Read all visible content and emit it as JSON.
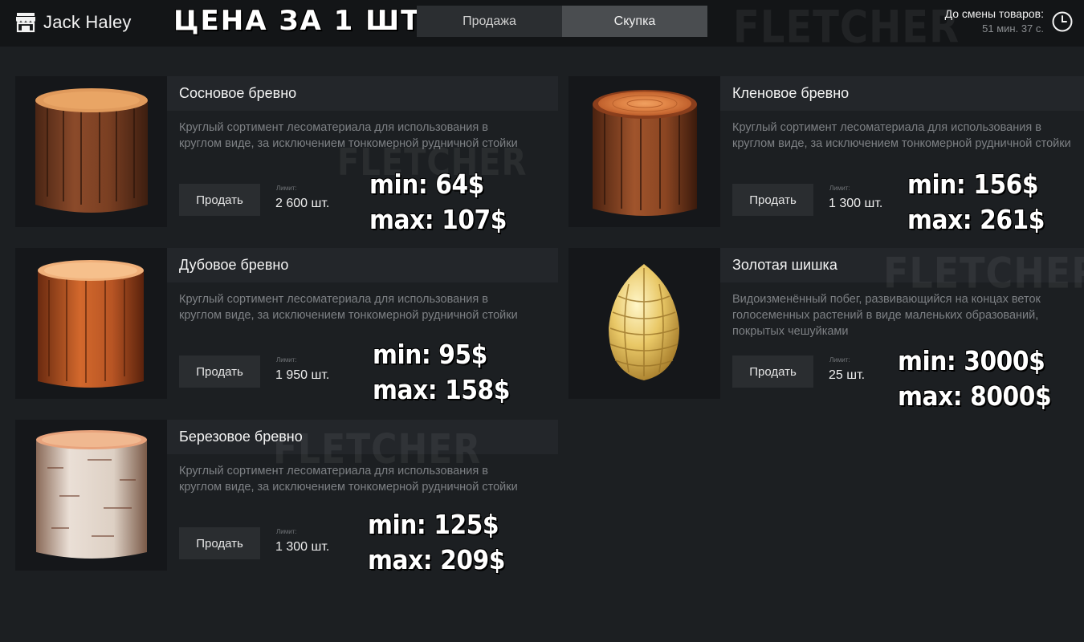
{
  "header": {
    "user_name": "Jack Haley",
    "overlay_title": "ЦЕНА ЗА 1 ШТ.",
    "tabs": [
      {
        "label": "Продажа",
        "active": false
      },
      {
        "label": "Скупка",
        "active": true
      }
    ],
    "timer_label": "До смены товаров:",
    "timer_value": "51 мин. 37 с.",
    "watermark": "FLETCHER"
  },
  "common": {
    "sell_label": "Продать",
    "limit_label": "Лимит:"
  },
  "items": [
    {
      "name": "Сосновое бревно",
      "description": "Круглый сортимент лесоматериала для использования в круглом виде, за исключением тонкомерной рудничной стойки",
      "limit": "2 600 шт.",
      "min": "min: 64$",
      "max": "max: 107$",
      "image": "pine-log"
    },
    {
      "name": "Кленовое бревно",
      "description": "Круглый сортимент лесоматериала для использования в круглом виде, за исключением тонкомерной рудничной стойки",
      "limit": "1 300 шт.",
      "min": "min: 156$",
      "max": "max: 261$",
      "image": "maple-log"
    },
    {
      "name": "Дубовое бревно",
      "description": "Круглый сортимент лесоматериала для использования в круглом виде, за исключением тонкомерной рудничной стойки",
      "limit": "1 950 шт.",
      "min": "min: 95$",
      "max": "max: 158$",
      "image": "oak-log"
    },
    {
      "name": "Золотая шишка",
      "description": "Видоизменённый побег, развивающийся на концах веток голосеменных растений в виде маленьких образований, покрытых чешуйками",
      "limit": "25 шт.",
      "min": "min: 3000$",
      "max": "max: 8000$",
      "image": "golden-cone"
    },
    {
      "name": "Березовое бревно",
      "description": "Круглый сортимент лесоматериала для использования в круглом виде, за исключением тонкомерной рудничной стойки",
      "limit": "1 300 шт.",
      "min": "min: 125$",
      "max": "max: 209$",
      "image": "birch-log"
    }
  ],
  "colors": {
    "background": "#1c1f22",
    "header": "#131517",
    "tab_active": "#4a4d50",
    "tab_inactive": "#2b2e31"
  }
}
